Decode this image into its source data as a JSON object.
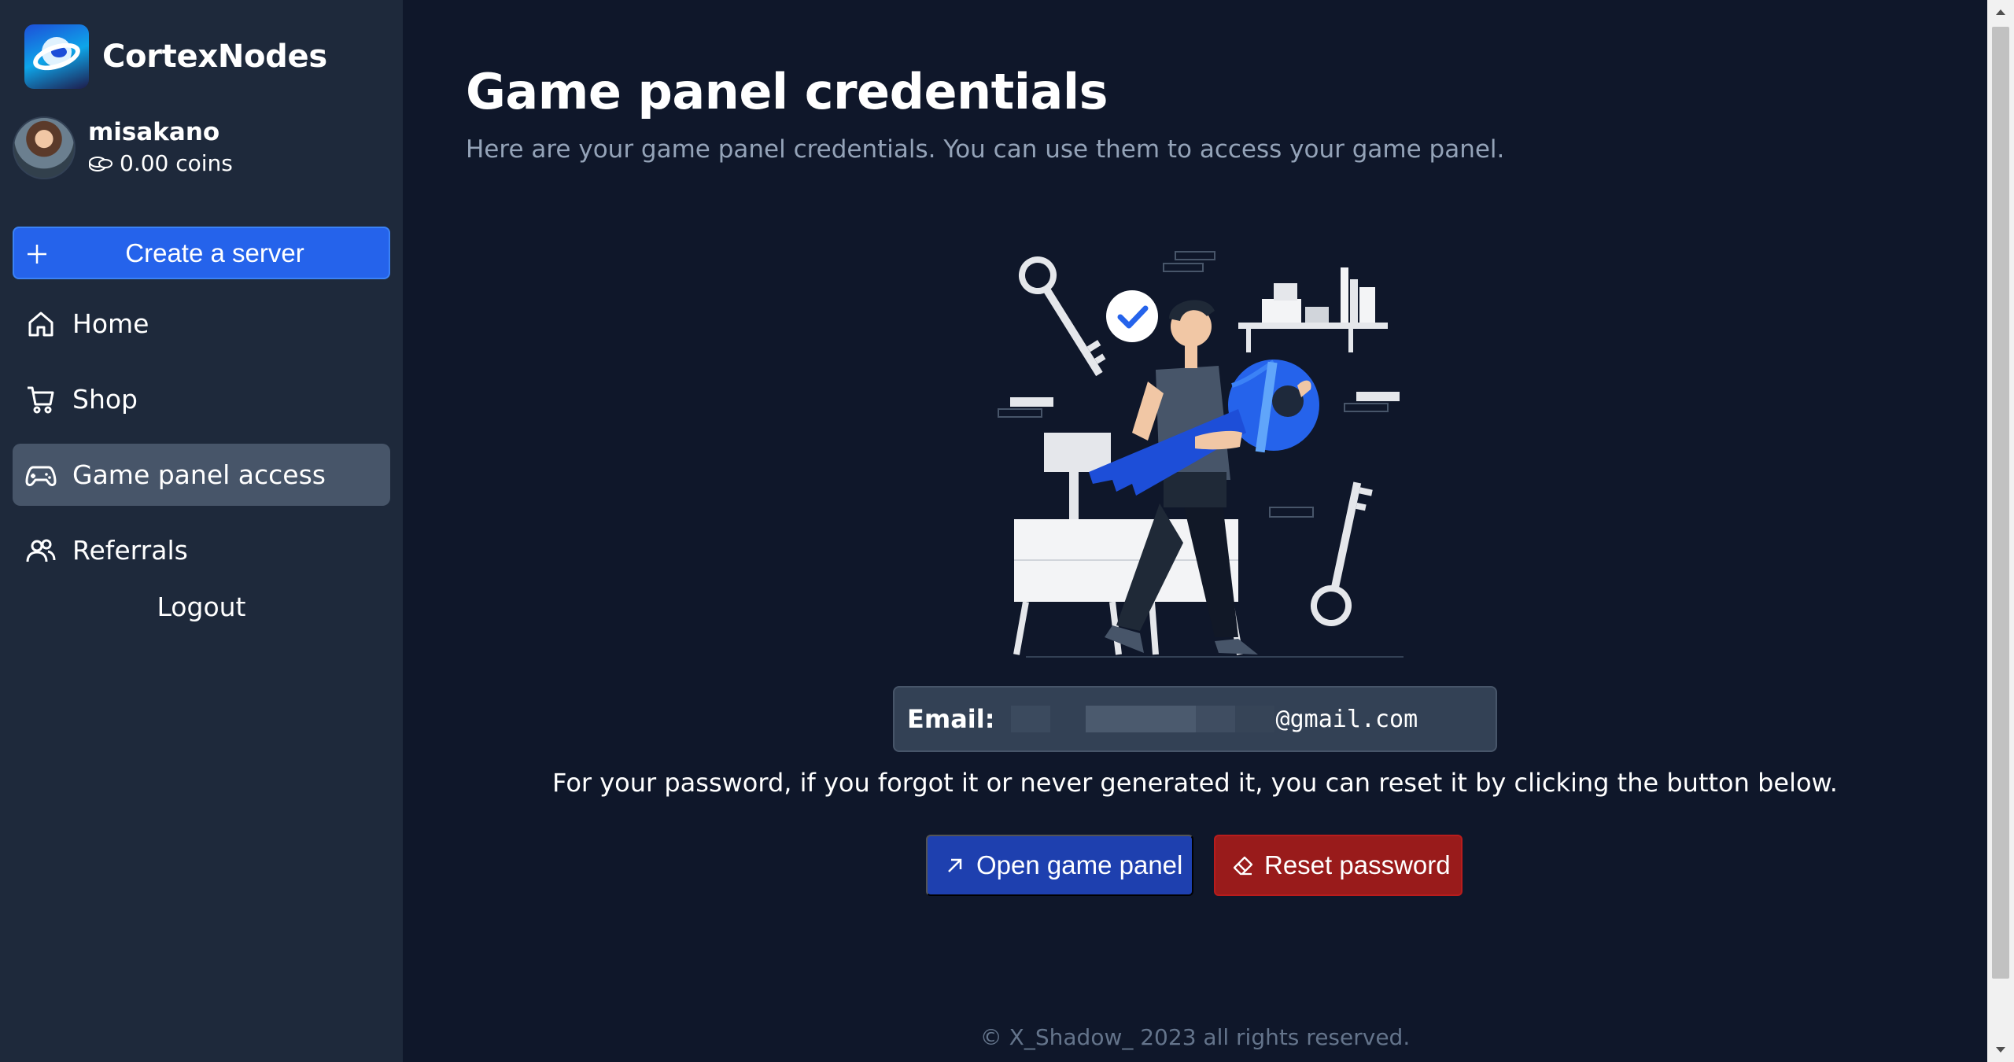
{
  "brand": {
    "name": "CortexNodes"
  },
  "user": {
    "name": "misakano",
    "coins": "0.00 coins"
  },
  "sidebar": {
    "create_label": "Create a server",
    "items": [
      {
        "label": "Home",
        "icon": "home-icon",
        "active": false
      },
      {
        "label": "Shop",
        "icon": "cart-icon",
        "active": false
      },
      {
        "label": "Game panel access",
        "icon": "gamepad-icon",
        "active": true
      },
      {
        "label": "Referrals",
        "icon": "users-icon",
        "active": false
      }
    ],
    "logout_label": "Logout"
  },
  "main": {
    "title": "Game panel credentials",
    "subtitle": "Here are your game panel credentials. You can use them to access your game panel.",
    "email_label": "Email:",
    "email_domain": "@gmail.com",
    "info_text": "For your password, if you forgot it or never generated it, you can reset it by clicking the button below.",
    "open_panel_label": "Open game panel",
    "reset_password_label": "Reset password"
  },
  "footer": {
    "text": "© X_Shadow_ 2023 all rights reserved."
  },
  "colors": {
    "background": "#0f172a",
    "sidebar": "#1e293b",
    "primary": "#2563eb",
    "open_button": "#1e40af",
    "danger": "#991b1b",
    "active_nav": "#475569"
  }
}
